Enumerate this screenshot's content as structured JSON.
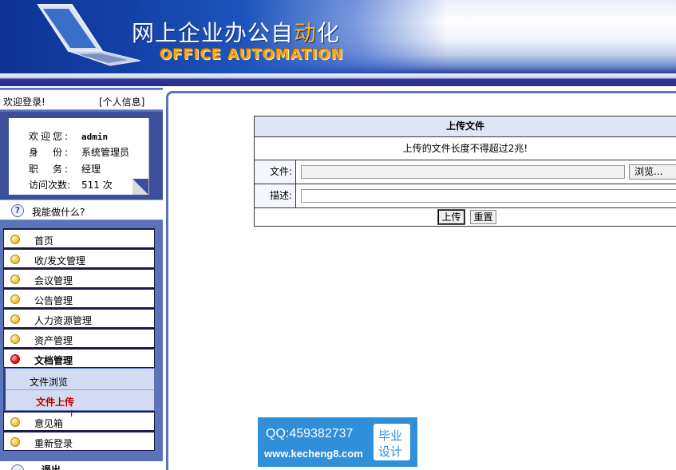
{
  "header": {
    "title_main": "网上企业办公自",
    "title_accent": "动",
    "title_end": "化",
    "subtitle": "OFFICE AUTOMATION"
  },
  "sidebar": {
    "welcome": "欢迎登录!",
    "profile_link": "[个人信息]",
    "info": {
      "welcome_label": "欢迎您:",
      "welcome_value": "admin",
      "role_label": "身　份:",
      "role_value": "系统管理员",
      "title_label": "职　务:",
      "title_value": "经理",
      "visits_label": "访问次数:",
      "visits_value": "511 次"
    },
    "help_label": "我能做什么?",
    "menu": [
      {
        "label": "首页"
      },
      {
        "label": "收/发文管理"
      },
      {
        "label": "会议管理"
      },
      {
        "label": "公告管理"
      },
      {
        "label": "人力资源管理"
      },
      {
        "label": "资产管理"
      },
      {
        "label": "文档管理"
      }
    ],
    "submenu": {
      "browse": "文件浏览",
      "upload": "文件上传"
    },
    "menu_after": [
      {
        "label": "意见箱"
      },
      {
        "label": "重新登录"
      }
    ],
    "logout_label": "退出"
  },
  "upload": {
    "heading": "上传文件",
    "note": "上传的文件长度不得超过2兆!",
    "file_label": "文件:",
    "browse_button": "浏览...",
    "desc_label": "描述:",
    "submit_button": "上传",
    "reset_button": "重置"
  },
  "watermark": {
    "qq": "QQ:459382737",
    "url": "www.kecheng8.com",
    "badge_line1": "毕业",
    "badge_line2": "设计"
  }
}
